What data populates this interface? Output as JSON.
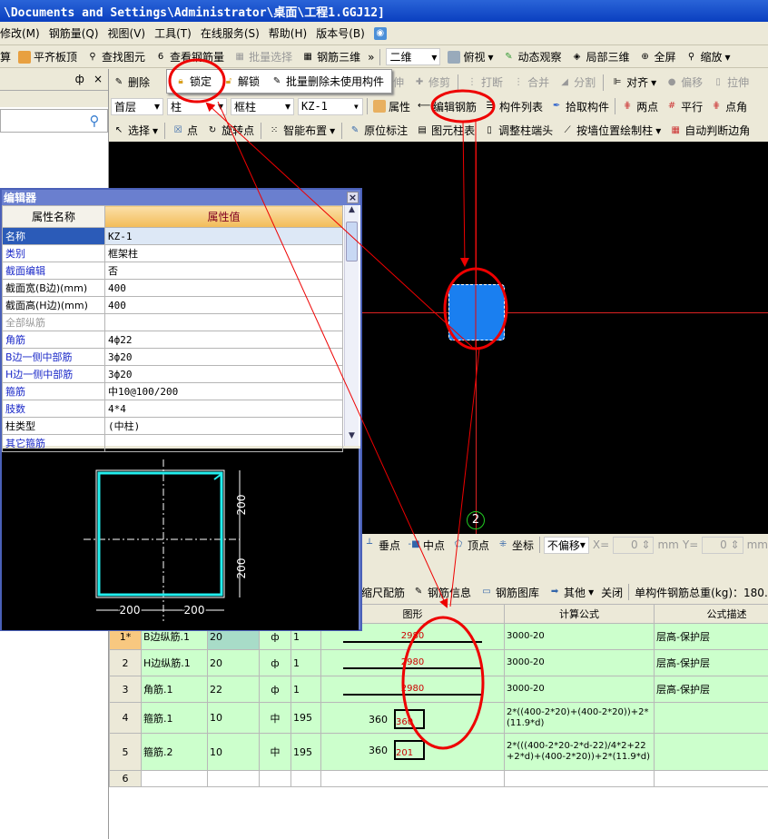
{
  "title": "\\Documents and Settings\\Administrator\\桌面\\工程1.GGJ12]",
  "menu": [
    "修改(M)",
    "钢筋量(Q)",
    "视图(V)",
    "工具(T)",
    "在线服务(S)",
    "帮助(H)",
    "版本号(B)"
  ],
  "toolbar1": {
    "items": [
      "算",
      "平齐板顶",
      "查找图元",
      "查看钢筋量",
      "批量选择",
      "钢筋三维"
    ],
    "more": "»",
    "view_mode": "二维",
    "items2": [
      "俯视",
      "动态观察",
      "局部三维",
      "全屏",
      "缩放"
    ]
  },
  "left_panel": {
    "pin": "ф",
    "close": "×",
    "search_icon": "search-icon"
  },
  "toolbar2": {
    "delete": "删除",
    "popup": [
      "锁定",
      "解锁",
      "批量删除未使用构件"
    ],
    "items": [
      "延伸",
      "修剪",
      "打断",
      "合并",
      "分割",
      "对齐",
      "偏移",
      "拉伸"
    ]
  },
  "toolbar3": {
    "floor": "首层",
    "type": "柱",
    "subtype": "框柱",
    "component": "KZ-1",
    "items": [
      "属性",
      "编辑钢筋",
      "构件列表",
      "拾取构件",
      "两点",
      "平行",
      "点角"
    ]
  },
  "toolbar4": {
    "items": [
      "选择",
      "点",
      "旋转点",
      "智能布置",
      "原位标注",
      "图元柱表",
      "调整柱端头",
      "按墙位置绘制柱",
      "自动判断边角"
    ]
  },
  "canvas": {
    "axis_label": "2"
  },
  "snap": {
    "items": [
      "垂点",
      "中点",
      "顶点",
      "坐标"
    ],
    "offset": "不偏移",
    "x_label": "X=",
    "x_value": "0",
    "y_label": "Y=",
    "y_value": "0",
    "unit": "mm"
  },
  "rebar_toolbar": {
    "items": [
      "缩尺配筋",
      "钢筋信息",
      "钢筋图库",
      "其他",
      "关闭"
    ],
    "total_label": "单构件钢筋总重(kg)：180."
  },
  "rebar_table": {
    "headers": [
      "图形",
      "计算公式",
      "公式描述"
    ],
    "rows": [
      {
        "no": "1*",
        "name": "B边纵筋.1",
        "dia": "20",
        "grade": "ф",
        "fig": "1",
        "shape_left": "",
        "shape_val": "2980",
        "formula": "3000-20",
        "desc": "层高-保护层"
      },
      {
        "no": "2",
        "name": "H边纵筋.1",
        "dia": "20",
        "grade": "ф",
        "fig": "1",
        "shape_left": "",
        "shape_val": "2980",
        "formula": "3000-20",
        "desc": "层高-保护层"
      },
      {
        "no": "3",
        "name": "角筋.1",
        "dia": "22",
        "grade": "ф",
        "fig": "1",
        "shape_left": "",
        "shape_val": "2980",
        "formula": "3000-20",
        "desc": "层高-保护层"
      },
      {
        "no": "4",
        "name": "箍筋.1",
        "dia": "10",
        "grade": "中",
        "fig": "195",
        "shape_left": "360",
        "shape_val": "360",
        "formula": "2*((400-2*20)+(400-2*20))+2*(11.9*d)",
        "desc": ""
      },
      {
        "no": "5",
        "name": "箍筋.2",
        "dia": "10",
        "grade": "中",
        "fig": "195",
        "shape_left": "360",
        "shape_val": "201",
        "formula": "2*(((400-2*20-2*d-22)/4*2+22+2*d)+(400-2*20))+2*(11.9*d)",
        "desc": ""
      },
      {
        "no": "6",
        "name": "",
        "dia": "",
        "grade": "",
        "fig": "",
        "shape_left": "",
        "shape_val": "",
        "formula": "",
        "desc": ""
      }
    ]
  },
  "dialog": {
    "title": "编辑器",
    "close": "×",
    "headers": [
      "属性名称",
      "属性值"
    ],
    "rows": [
      {
        "name": "名称",
        "value": "KZ-1",
        "style": "selected"
      },
      {
        "name": "类别",
        "value": "框架柱",
        "style": "blue"
      },
      {
        "name": "截面编辑",
        "value": "否",
        "style": "blue"
      },
      {
        "name": "截面宽(B边)(mm)",
        "value": "400",
        "style": "black"
      },
      {
        "name": "截面高(H边)(mm)",
        "value": "400",
        "style": "black"
      },
      {
        "name": "全部纵筋",
        "value": "",
        "style": "gray"
      },
      {
        "name": "角筋",
        "value": "4ф22",
        "style": "blue"
      },
      {
        "name": "B边一侧中部筋",
        "value": "3ф20",
        "style": "blue"
      },
      {
        "name": "H边一侧中部筋",
        "value": "3ф20",
        "style": "blue"
      },
      {
        "name": "箍筋",
        "value": "中10@100/200",
        "style": "blue"
      },
      {
        "name": "肢数",
        "value": "4*4",
        "style": "blue"
      },
      {
        "name": "柱类型",
        "value": "(中柱)",
        "style": "black"
      },
      {
        "name": "其它箍筋",
        "value": "",
        "style": "blue"
      }
    ],
    "preview": {
      "dim_right_top": "200",
      "dim_right_bottom": "200",
      "dim_bottom_left": "200",
      "dim_bottom_right": "200"
    }
  },
  "colors": {
    "annotation": "#e00000",
    "column": "#1a7ff0",
    "rebar_table_bg": "#ccffcc",
    "dialog_header": "#f5c060",
    "selected_row": "#2b5bb8"
  }
}
